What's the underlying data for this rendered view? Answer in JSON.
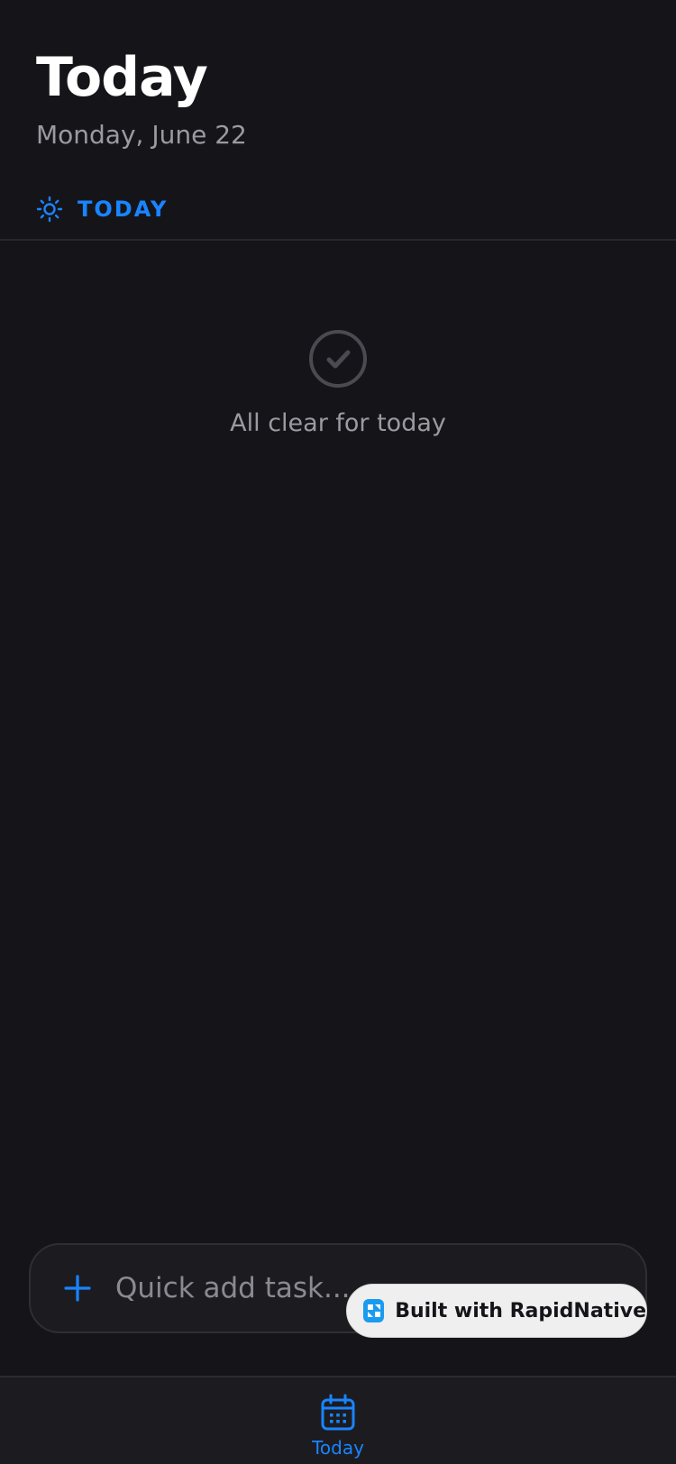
{
  "header": {
    "title": "Today",
    "date": "Monday, June 22"
  },
  "section": {
    "label": "TODAY",
    "icon": "sun-icon"
  },
  "empty_state": {
    "icon": "check-circle-icon",
    "message": "All clear for today"
  },
  "quick_add": {
    "icon": "plus-icon",
    "placeholder": "Quick add task..."
  },
  "badge": {
    "text": "Built with RapidNative"
  },
  "tab_bar": {
    "items": [
      {
        "label": "Today",
        "icon": "calendar-icon",
        "active": true
      }
    ]
  },
  "colors": {
    "background": "#151519",
    "accent": "#1a84ff",
    "muted_text": "#9a9aa0",
    "surface": "#1c1c20"
  }
}
